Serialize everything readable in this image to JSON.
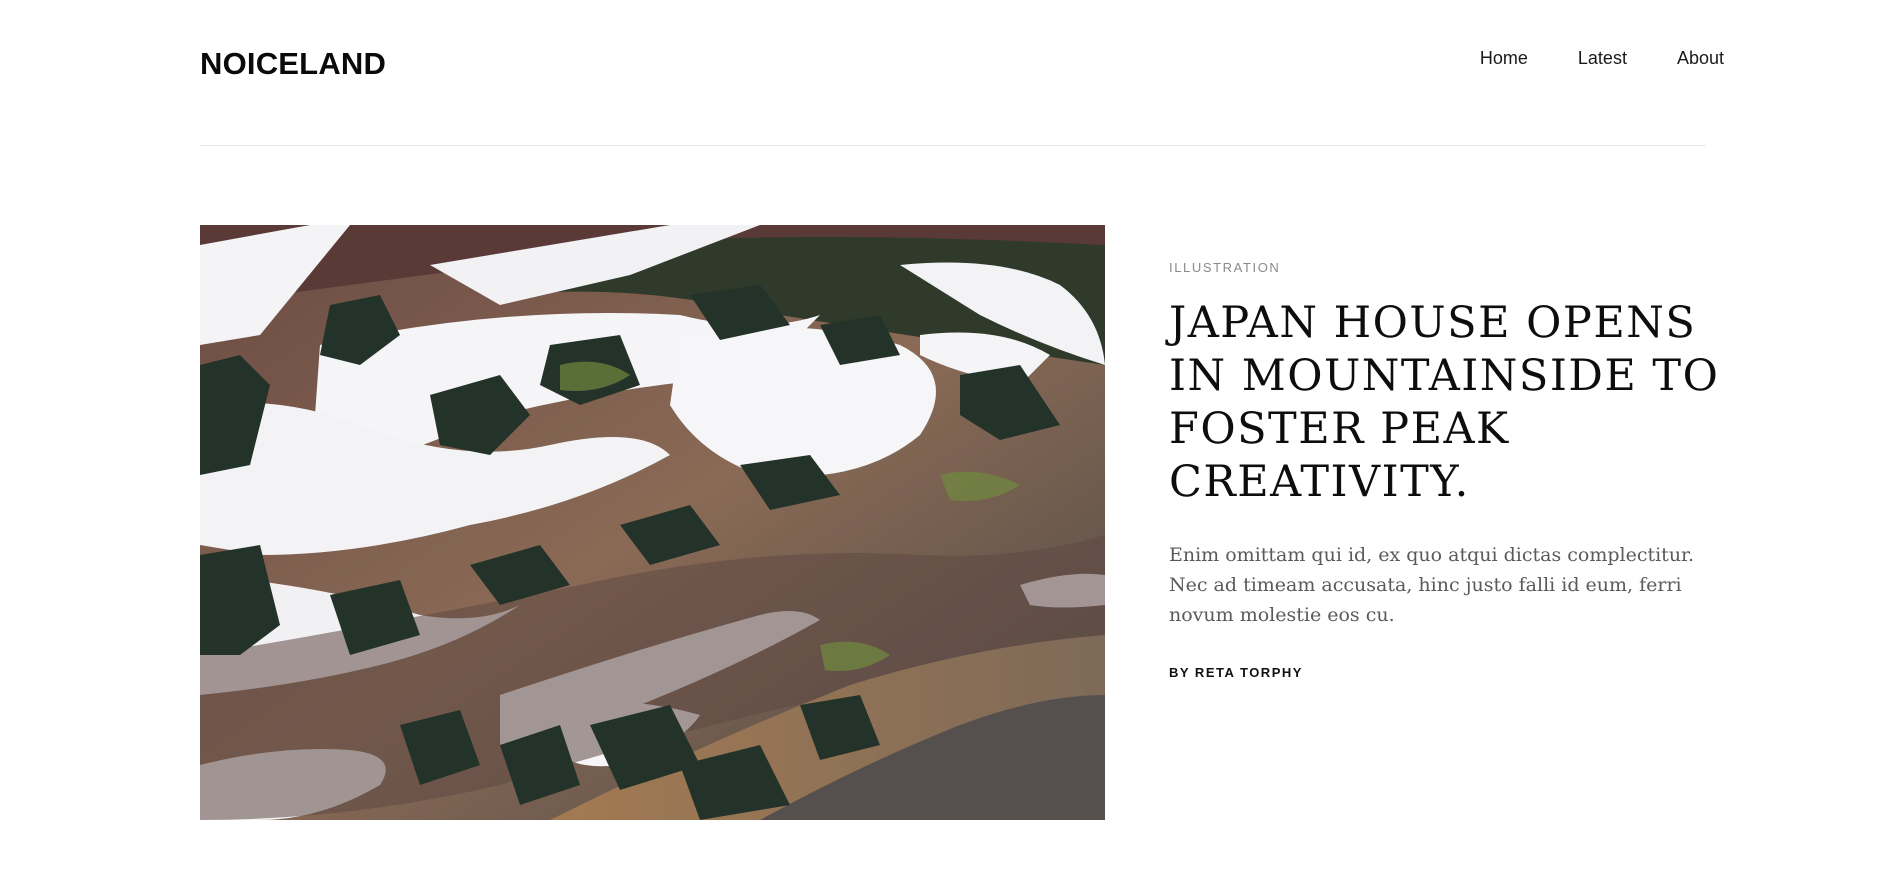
{
  "header": {
    "brand": "NOICELAND",
    "nav": [
      {
        "label": "Home"
      },
      {
        "label": "Latest"
      },
      {
        "label": "About"
      }
    ]
  },
  "feature": {
    "image_icon": "mountain-landscape-image",
    "category": "ILLUSTRATION",
    "headline": "JAPAN HOUSE OPENS IN MOUNTAINSIDE TO FOSTER PEAK CREATIVITY.",
    "excerpt": "Enim omittam qui id, ex quo atqui dictas complectitur. Nec ad timeam accusata, hinc justo falli id eum, ferri novum molestie eos cu.",
    "byline": "BY RETA TORPHY"
  },
  "colors": {
    "background": "#ffffff",
    "text": "#111111",
    "muted": "#8a8a8a",
    "excerpt": "#5a5a5a",
    "divider": "#e6e6e6"
  }
}
